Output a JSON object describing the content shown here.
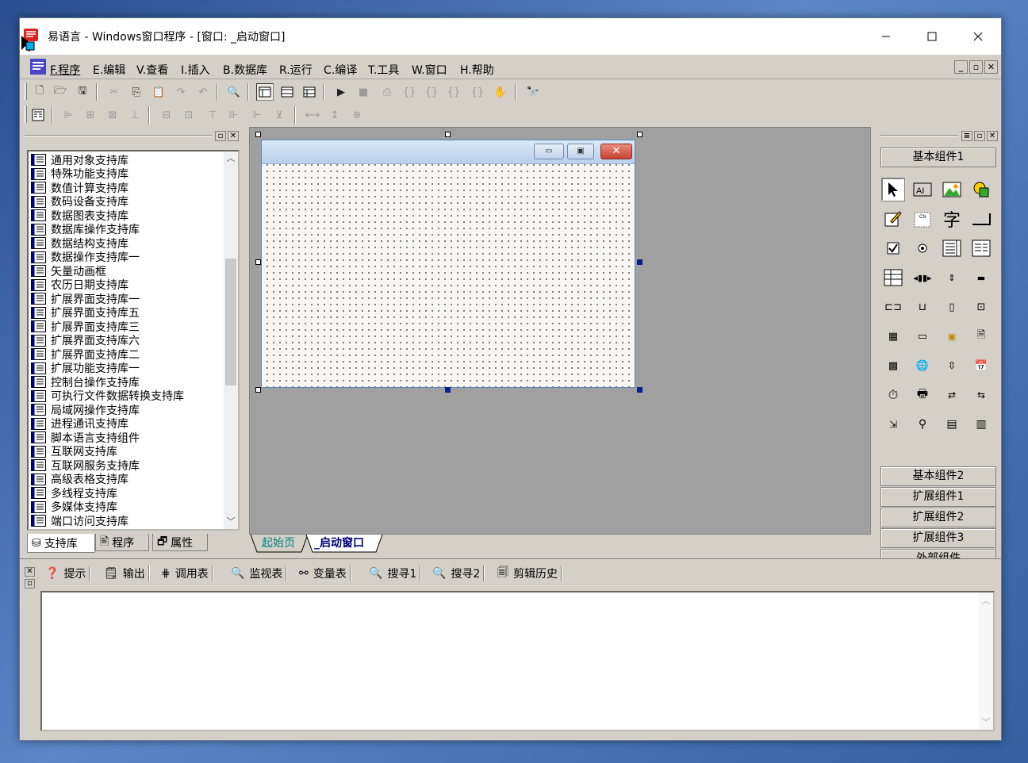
{
  "window": {
    "title": "易语言 - Windows窗口程序 - [窗口: _启动窗口]",
    "minimize_icon": "minimize-icon",
    "maximize_icon": "maximize-icon",
    "close_icon": "close-icon"
  },
  "menu": {
    "items": [
      "F.程序",
      "E.编辑",
      "V.查看",
      "I.插入",
      "B.数据库",
      "R.运行",
      "C.编译",
      "T.工具",
      "W.窗口",
      "H.帮助"
    ],
    "mdi_buttons": [
      "_",
      "▫",
      "✕"
    ]
  },
  "toolbar1": {
    "icons": [
      "new-file-icon",
      "open-folder-icon",
      "save-icon",
      "cut-icon",
      "copy-icon",
      "paste-icon",
      "redo-icon",
      "undo-icon",
      "find-icon",
      "layout1-icon",
      "layout2-icon",
      "layout3-icon",
      "run-icon",
      "stop-icon",
      "step-icon",
      "step-in-icon",
      "step-out-icon",
      "run-to-icon",
      "trace-icon",
      "hand-icon",
      "binoculars-icon"
    ]
  },
  "toolbar2": {
    "icons": [
      "form-icon",
      "align-left-icon",
      "align-center-icon",
      "align-right-icon",
      "align-top-icon",
      "same-width-icon",
      "same-height-icon",
      "center-h-icon",
      "center-v-icon",
      "space-h-icon",
      "space-v-icon",
      "size-h-icon",
      "size-v-icon",
      "size-both-icon"
    ]
  },
  "left_panel": {
    "libraries": [
      "通用对象支持库",
      "特殊功能支持库",
      "数值计算支持库",
      "数码设备支持库",
      "数据图表支持库",
      "数据库操作支持库",
      "数据结构支持库",
      "数据操作支持库一",
      "矢量动画框",
      "农历日期支持库",
      "扩展界面支持库一",
      "扩展界面支持库五",
      "扩展界面支持库三",
      "扩展界面支持库六",
      "扩展界面支持库二",
      "扩展功能支持库一",
      "控制台操作支持库",
      "可执行文件数据转换支持库",
      "局域网操作支持库",
      "进程通讯支持库",
      "脚本语言支持组件",
      "互联网支持库",
      "互联网服务支持库",
      "高级表格支持库",
      "多线程支持库",
      "多媒体支持库",
      "端口访问支持库"
    ],
    "tabs": [
      "支持库",
      "程序",
      "属性"
    ]
  },
  "design": {
    "tabs": [
      "起始页",
      "_启动窗口"
    ],
    "form_buttons": [
      "▭",
      "▣",
      "✕"
    ]
  },
  "right_panel": {
    "groups_top": [
      "基本组件1"
    ],
    "groups_bottom": [
      "基本组件2",
      "扩展组件1",
      "扩展组件2",
      "扩展组件3",
      "外部组件"
    ],
    "tool_label_text": "字"
  },
  "bottom_panel": {
    "tabs": [
      "提示",
      "输出",
      "调用表",
      "监视表",
      "变量表",
      "搜寻1",
      "搜寻2",
      "剪辑历史"
    ]
  }
}
